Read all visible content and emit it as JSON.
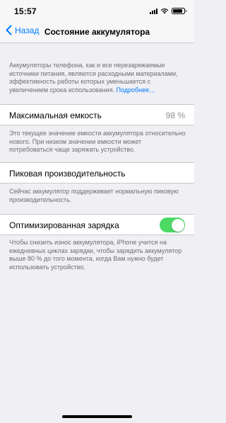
{
  "status_bar": {
    "time": "15:57"
  },
  "nav": {
    "back_label": "Назад",
    "title": "Состояние аккумулятора"
  },
  "intro": {
    "text": "Аккумуляторы телефона, как и все перезаряжаемые источники питания, являются расходными материалами, эффективность работы которых уменьшается с увеличением срока использования.",
    "link": "Подробнее…"
  },
  "max_capacity": {
    "label": "Максимальная емкость",
    "value": "98 %",
    "note": "Это текущее значение емкости аккумулятора относительно нового. При низком значении емкости может потребоваться чаще заряжать устройство."
  },
  "peak_performance": {
    "label": "Пиковая производительность",
    "note": "Сейчас аккумулятор поддерживает нормальную пиковую производительность."
  },
  "optimized_charging": {
    "label": "Оптимизированная зарядка",
    "enabled": true,
    "note": "Чтобы снизить износ аккумулятора, iPhone учится на ежедневных циклах зарядки, чтобы зарядить аккумулятор выше 80 % до того момента, когда Вам нужно будет использовать устройство."
  },
  "colors": {
    "accent": "#007aff",
    "toggle_on": "#4cd964",
    "background": "#efeff4"
  },
  "icons": [
    "signal-icon",
    "wifi-icon",
    "battery-icon",
    "chevron-left-icon"
  ]
}
